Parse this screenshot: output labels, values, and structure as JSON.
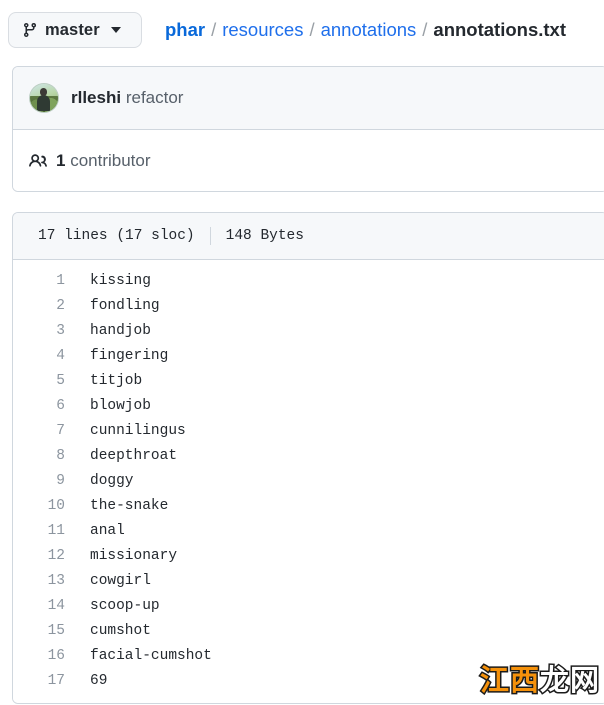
{
  "branch": {
    "label": "master",
    "icon": "git-branch-icon",
    "caret_icon": "chevron-down-icon"
  },
  "breadcrumb": {
    "root": "phar",
    "separator": "/",
    "links": [
      "resources",
      "annotations"
    ],
    "current": "annotations.txt"
  },
  "commit": {
    "author": "rlleshi",
    "message": "refactor",
    "avatar_name": "rlleshi-avatar"
  },
  "contributors": {
    "icon": "people-icon",
    "count": "1",
    "label": "contributor"
  },
  "file_meta": {
    "lines": "17 lines (17 sloc)",
    "size": "148 Bytes"
  },
  "file_content": {
    "lines": [
      {
        "number": "1",
        "text": "kissing"
      },
      {
        "number": "2",
        "text": "fondling"
      },
      {
        "number": "3",
        "text": "handjob"
      },
      {
        "number": "4",
        "text": "fingering"
      },
      {
        "number": "5",
        "text": "titjob"
      },
      {
        "number": "6",
        "text": "blowjob"
      },
      {
        "number": "7",
        "text": "cunnilingus"
      },
      {
        "number": "8",
        "text": "deepthroat"
      },
      {
        "number": "9",
        "text": "doggy"
      },
      {
        "number": "10",
        "text": "the-snake"
      },
      {
        "number": "11",
        "text": "anal"
      },
      {
        "number": "12",
        "text": "missionary"
      },
      {
        "number": "13",
        "text": "cowgirl"
      },
      {
        "number": "14",
        "text": "scoop-up"
      },
      {
        "number": "15",
        "text": "cumshot"
      },
      {
        "number": "16",
        "text": "facial-cumshot"
      },
      {
        "number": "17",
        "text": "69"
      }
    ]
  },
  "watermark": {
    "part1": "江西",
    "part2": "龙",
    "part3": "网"
  },
  "colors": {
    "link": "#1f6feb",
    "root_link": "#0969da",
    "text": "#24292f",
    "muted": "#57606a",
    "border": "#d0d7de",
    "panel_header": "#f6f8fa",
    "watermark_orange": "#f5910b"
  }
}
